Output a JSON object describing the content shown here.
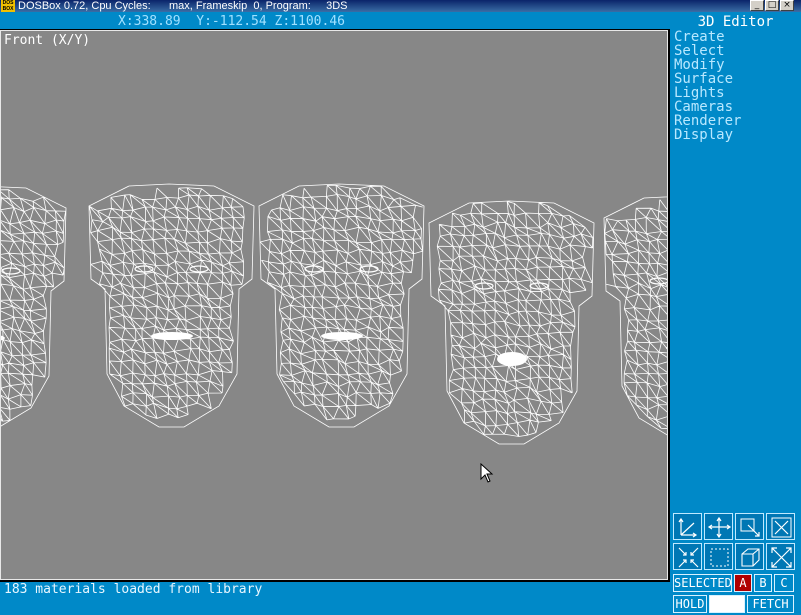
{
  "window": {
    "title": "DOSBox 0.72, Cpu Cycles:      max, Frameskip  0, Program:     3DS",
    "icon_text_top": "DOS",
    "icon_text_bottom": "BOX"
  },
  "coords": "X:338.89  Y:-112.54 Z:1100.46",
  "viewport": {
    "label": "Front (X/Y)",
    "background": "#878787",
    "mesh_color": "#ffffff"
  },
  "panel": {
    "title": "3D Editor",
    "menu": [
      "Create",
      "Select",
      "Modify",
      "Surface",
      "Lights",
      "Cameras",
      "Renderer",
      "Display"
    ],
    "icons": [
      "axis-icon",
      "move-icon",
      "zoom-window-icon",
      "close-view-icon",
      "zoom-extents-icon",
      "region-icon",
      "box-view-icon",
      "fullscreen-icon"
    ],
    "selected_label": "SELECTED",
    "sel_a": "A",
    "sel_b": "B",
    "sel_c": "C",
    "hold_label": "HOLD",
    "fetch_label": "FETCH"
  },
  "status": "183 materials loaded from library",
  "colors": {
    "panel": "#0089c8",
    "active": "#b00000",
    "menu_text": "#b8e8ff"
  }
}
